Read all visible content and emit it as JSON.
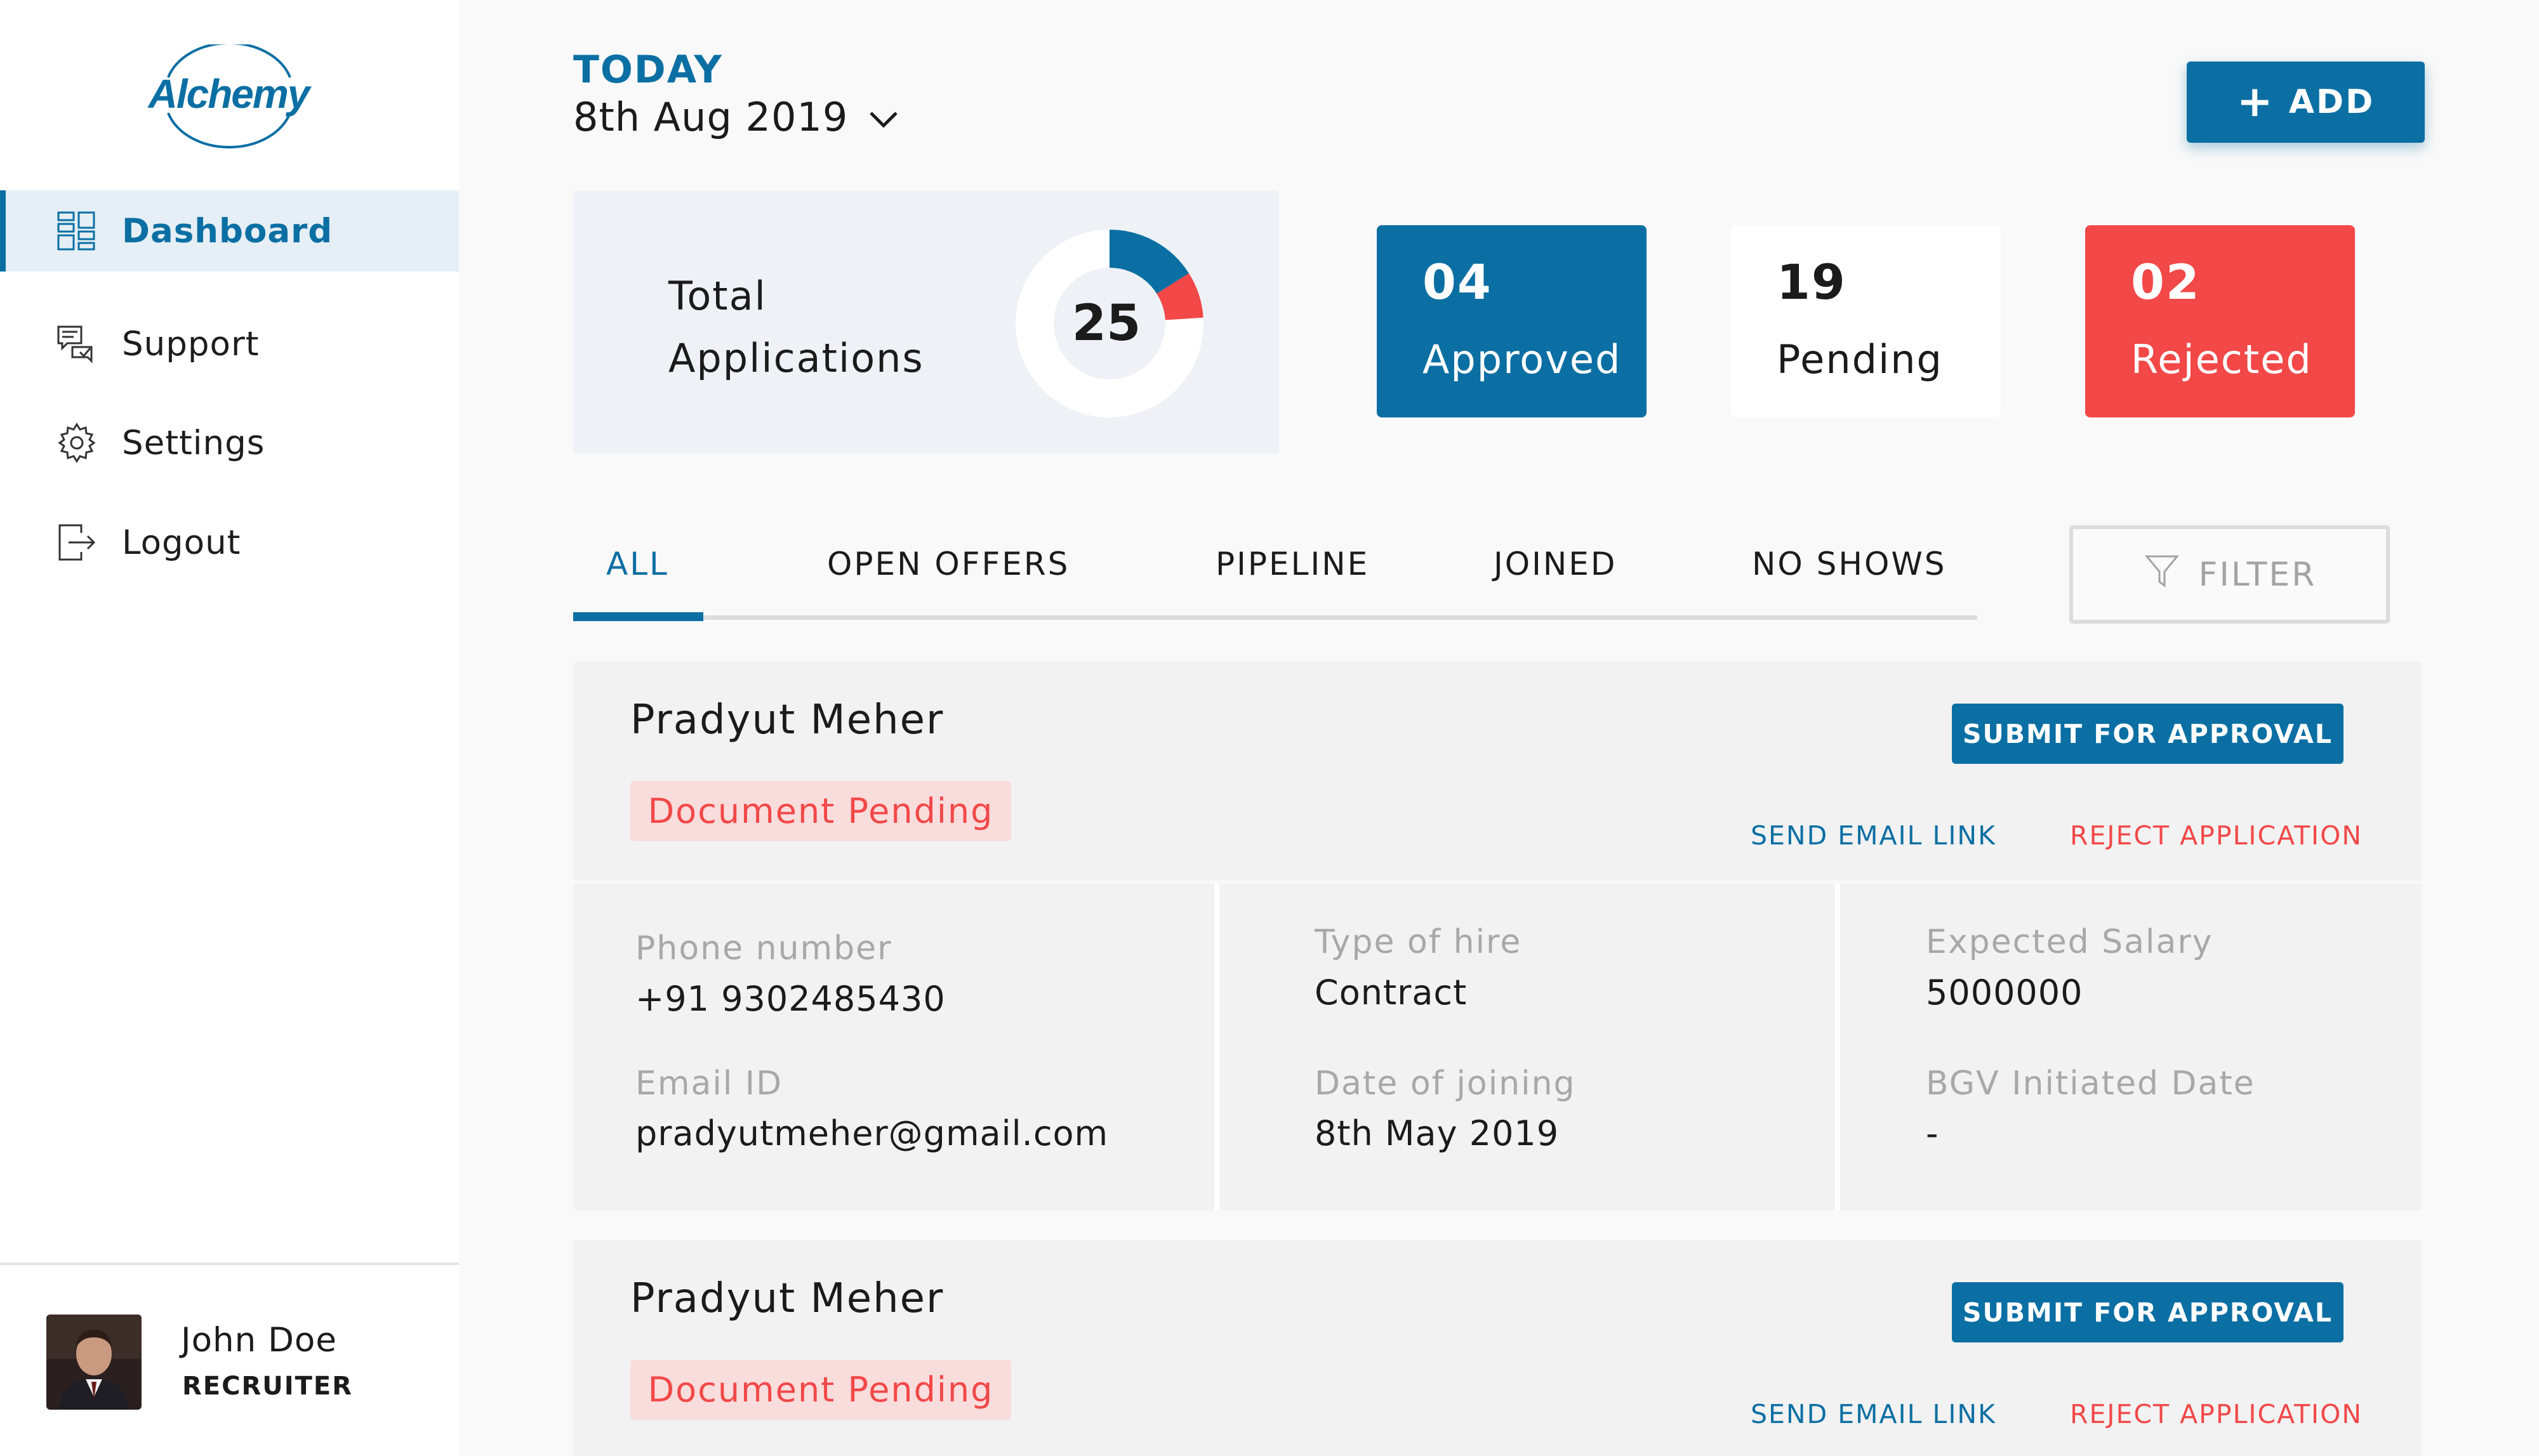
{
  "brand": {
    "logo_text": "Alchemy",
    "accent": "#0b6fa3",
    "danger": "#f24848"
  },
  "sidebar": {
    "items": [
      {
        "label": "Dashboard",
        "icon": "dashboard-icon",
        "active": true
      },
      {
        "label": "Support",
        "icon": "chat-icon",
        "active": false
      },
      {
        "label": "Settings",
        "icon": "gear-icon",
        "active": false
      },
      {
        "label": "Logout",
        "icon": "logout-icon",
        "active": false
      }
    ],
    "user": {
      "name": "John Doe",
      "role": "RECRUITER"
    }
  },
  "header": {
    "today_label": "TODAY",
    "date": "8th Aug 2019",
    "add_label": "ADD"
  },
  "summary": {
    "total_label_line1": "Total",
    "total_label_line2": "Applications",
    "total": "25",
    "approved": {
      "count": "04",
      "label": "Approved"
    },
    "pending": {
      "count": "19",
      "label": "Pending"
    },
    "rejected": {
      "count": "02",
      "label": "Rejected"
    }
  },
  "tabs": [
    "ALL",
    "OPEN OFFERS",
    "PIPELINE",
    "JOINED",
    "NO SHOWS"
  ],
  "filter_label": "FILTER",
  "applications": [
    {
      "name": "Pradyut Meher",
      "status": "Document Pending",
      "submit_label": "SUBMIT FOR APPROVAL",
      "email_link_label": "SEND EMAIL LINK",
      "reject_label": "REJECT APPLICATION",
      "fields": {
        "phone_label": "Phone number",
        "phone": "+91 9302485430",
        "email_label": "Email ID",
        "email": "pradyutmeher@gmail.com",
        "hire_type_label": "Type of hire",
        "hire_type": "Contract",
        "joining_label": "Date of joining",
        "joining": "8th May 2019",
        "salary_label": "Expected Salary",
        "salary": "5000000",
        "bgv_label": "BGV Initiated Date",
        "bgv": "-"
      }
    },
    {
      "name": "Pradyut Meher",
      "status": "Document Pending",
      "submit_label": "SUBMIT FOR APPROVAL",
      "email_link_label": "SEND EMAIL LINK",
      "reject_label": "REJECT APPLICATION"
    }
  ]
}
